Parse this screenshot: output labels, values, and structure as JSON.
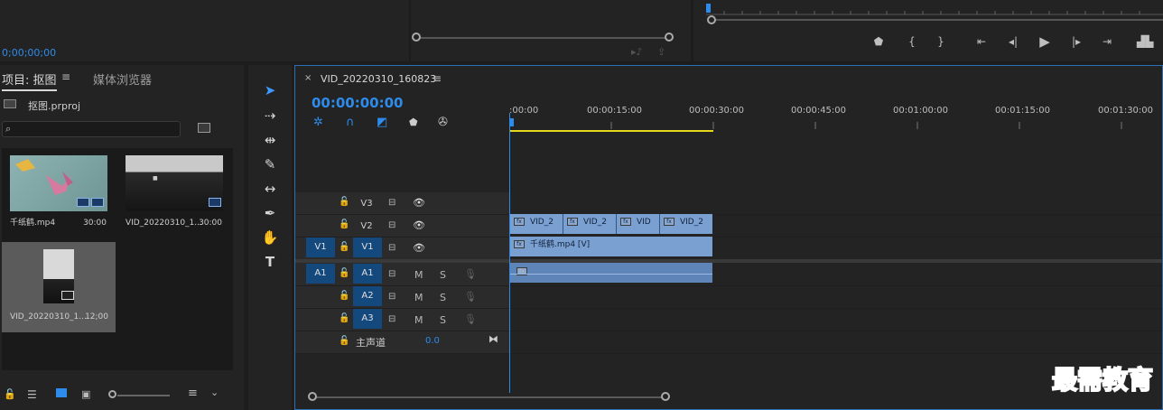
{
  "top": {
    "timecode": "0;00;00;00"
  },
  "project": {
    "tab_project": "项目: 抠图",
    "tab_media": "媒体浏览器",
    "file_name": "抠图.prproj",
    "search_placeholder": "",
    "items": [
      {
        "name": "千纸鹤.mp4",
        "duration": "30:00"
      },
      {
        "name": "VID_20220310_1...",
        "duration": "30:00"
      },
      {
        "name": "VID_20220310_1...",
        "duration": "12;00"
      }
    ]
  },
  "timeline": {
    "sequence_name": "VID_20220310_160823",
    "timecode": "00:00:00:00",
    "ruler": [
      ":00:00",
      "00:00:15:00",
      "00:00:30:00",
      "00:00:45:00",
      "00:01:00:00",
      "00:01:15:00",
      "00:01:30:00"
    ],
    "video_tracks": [
      {
        "name": "V3",
        "source": ""
      },
      {
        "name": "V2",
        "source": ""
      },
      {
        "name": "V1",
        "source": "V1"
      }
    ],
    "audio_tracks": [
      {
        "name": "A1",
        "source": "A1",
        "m": "M",
        "s": "S"
      },
      {
        "name": "A2",
        "source": "",
        "m": "M",
        "s": "S"
      },
      {
        "name": "A3",
        "source": "",
        "m": "M",
        "s": "S"
      }
    ],
    "master_label": "主声道",
    "master_value": "0.0",
    "v2_clips": [
      "VID_2",
      "VID_2",
      "VID",
      "VID_2"
    ],
    "v1_clip": "千纸鹤.mp4 [V]",
    "fx_label": "fx"
  },
  "watermark": "最需教育",
  "colors": {
    "accent": "#2d8ceb",
    "clip": "#7a9fd1",
    "track_source": "#14497e"
  }
}
